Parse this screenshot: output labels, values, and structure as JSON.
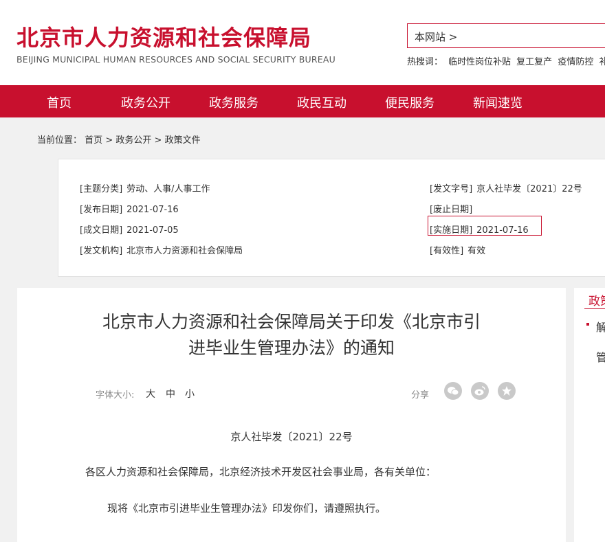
{
  "header": {
    "logo_cn": "北京市人力资源和社会保障局",
    "logo_en": "BEIJING MUNICIPAL HUMAN RESOURCES AND SOCIAL SECURITY BUREAU",
    "search_scope": "本网站 >",
    "hot_label": "热搜词：",
    "hot_words": [
      "临时性岗位补贴",
      "复工复产",
      "疫情防控",
      "补"
    ]
  },
  "nav": {
    "items": [
      "首页",
      "政务公开",
      "政务服务",
      "政民互动",
      "便民服务",
      "新闻速览"
    ]
  },
  "breadcrumb": {
    "prefix": "当前位置：",
    "items": [
      "首页",
      "政务公开",
      "政策文件"
    ],
    "separator": ">"
  },
  "meta": {
    "topic_key": "[主题分类]",
    "topic_val": "劳动、人事/人事工作",
    "publish_key": "[发布日期]",
    "publish_val": "2021-07-16",
    "written_key": "[成文日期]",
    "written_val": "2021-07-05",
    "org_key": "[发文机构]",
    "org_val": "北京市人力资源和社会保障局",
    "docno_key": "[发文字号]",
    "docno_val": "京人社毕发〔2021〕22号",
    "repeal_key": "[废止日期]",
    "repeal_val": "",
    "effective_key": "[实施日期]",
    "effective_val": "2021-07-16",
    "validity_key": "[有效性]",
    "validity_val": "有效"
  },
  "article": {
    "title_line1": "北京市人力资源和社会保障局关于印发《北京市引",
    "title_line2": "进毕业生管理办法》的通知",
    "font_size_label": "字体大小:",
    "font_sizes": [
      "大",
      "中",
      "小"
    ],
    "share_label": "分享",
    "share_icons": [
      "wechat-icon",
      "weibo-icon",
      "favorite-icon"
    ],
    "doc_number": "京人社毕发〔2021〕22号",
    "para1": "各区人力资源和社会保障局，北京经济技术开发区社会事业局，各有关单位：",
    "para2": "现将《北京市引进毕业生管理办法》印发你们，请遵照执行。"
  },
  "side": {
    "tab": "政策",
    "item1": "解",
    "item2": "管"
  },
  "colors": {
    "brand_red": "#c8102e",
    "background": "#f1f1f1"
  }
}
